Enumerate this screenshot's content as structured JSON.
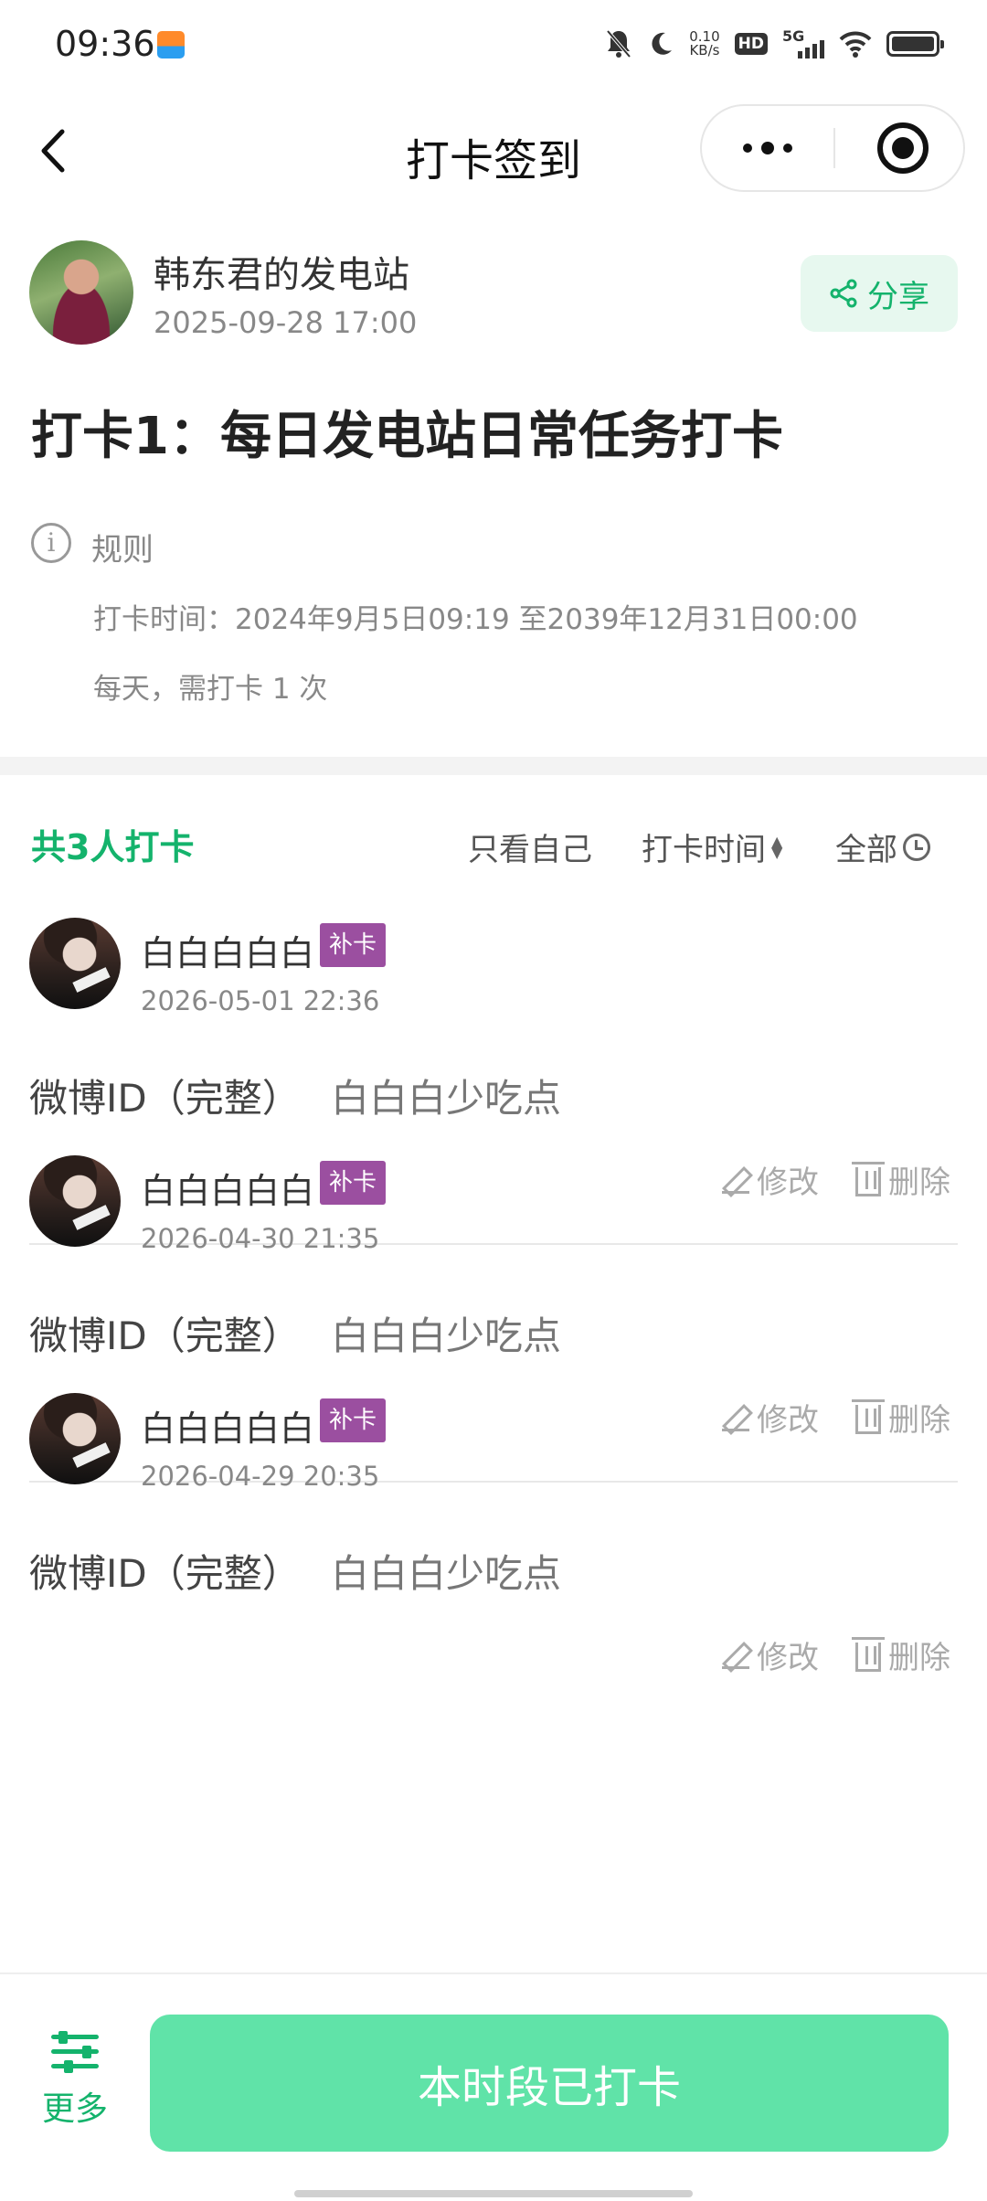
{
  "status_bar": {
    "time": "09:36",
    "net_speed_value": "0.10",
    "net_speed_unit": "KB/s",
    "hd_label": "HD",
    "network_label": "5G"
  },
  "nav": {
    "title": "打卡签到"
  },
  "author": {
    "name": "韩东君的发电站",
    "date": "2025-09-28 17:00",
    "share_label": "分享"
  },
  "task": {
    "title": "打卡1：每日发电站日常任务打卡",
    "rule_label": "规则",
    "rule_time": "打卡时间：2024年9月5日09:19 至2039年12月31日00:00",
    "rule_frequency": "每天，需打卡 1 次"
  },
  "list_header": {
    "count_title": "共3人打卡",
    "filter_self": "只看自己",
    "filter_time": "打卡时间",
    "filter_all": "全部"
  },
  "entries": [
    {
      "name": "白白白白白",
      "tag": "补卡",
      "date": "2026-05-01 22:36",
      "field_label": "微博ID（完整）",
      "field_value": "白白白少吃点",
      "edit_label": "修改",
      "delete_label": "删除"
    },
    {
      "name": "白白白白白",
      "tag": "补卡",
      "date": "2026-04-30 21:35",
      "field_label": "微博ID（完整）",
      "field_value": "白白白少吃点",
      "edit_label": "修改",
      "delete_label": "删除"
    },
    {
      "name": "白白白白白",
      "tag": "补卡",
      "date": "2026-04-29 20:35",
      "field_label": "微博ID（完整）",
      "field_value": "白白白少吃点",
      "edit_label": "修改",
      "delete_label": "删除"
    }
  ],
  "bottom": {
    "more_label": "更多",
    "main_button_label": "本时段已打卡"
  },
  "colors": {
    "accent": "#14b36c",
    "button": "#60e3a8",
    "tag": "#9b4fa0"
  }
}
